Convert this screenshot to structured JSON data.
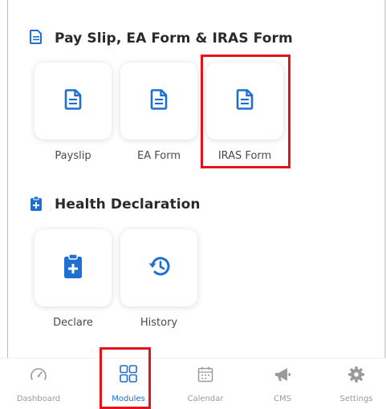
{
  "sections": {
    "payslip": {
      "title": "Pay Slip, EA Form & IRAS Form",
      "tiles": [
        {
          "label": "Payslip",
          "icon": "document-icon"
        },
        {
          "label": "EA Form",
          "icon": "document-icon"
        },
        {
          "label": "IRAS Form",
          "icon": "document-icon",
          "highlighted": true
        }
      ]
    },
    "health": {
      "title": "Health Declaration",
      "tiles": [
        {
          "label": "Declare",
          "icon": "clipboard-plus-icon"
        },
        {
          "label": "History",
          "icon": "history-icon"
        }
      ]
    }
  },
  "tabbar": {
    "tabs": [
      {
        "label": "Dashboard",
        "icon": "speedometer-icon"
      },
      {
        "label": "Modules",
        "icon": "grid-icon",
        "active": true,
        "highlighted": true
      },
      {
        "label": "Calendar",
        "icon": "calendar-icon"
      },
      {
        "label": "CMS",
        "icon": "megaphone-icon"
      },
      {
        "label": "Settings",
        "icon": "gear-icon"
      }
    ]
  },
  "colors": {
    "accent": "#1f6fd1",
    "highlight": "#e3141c",
    "inactive": "#9a9a9a"
  }
}
